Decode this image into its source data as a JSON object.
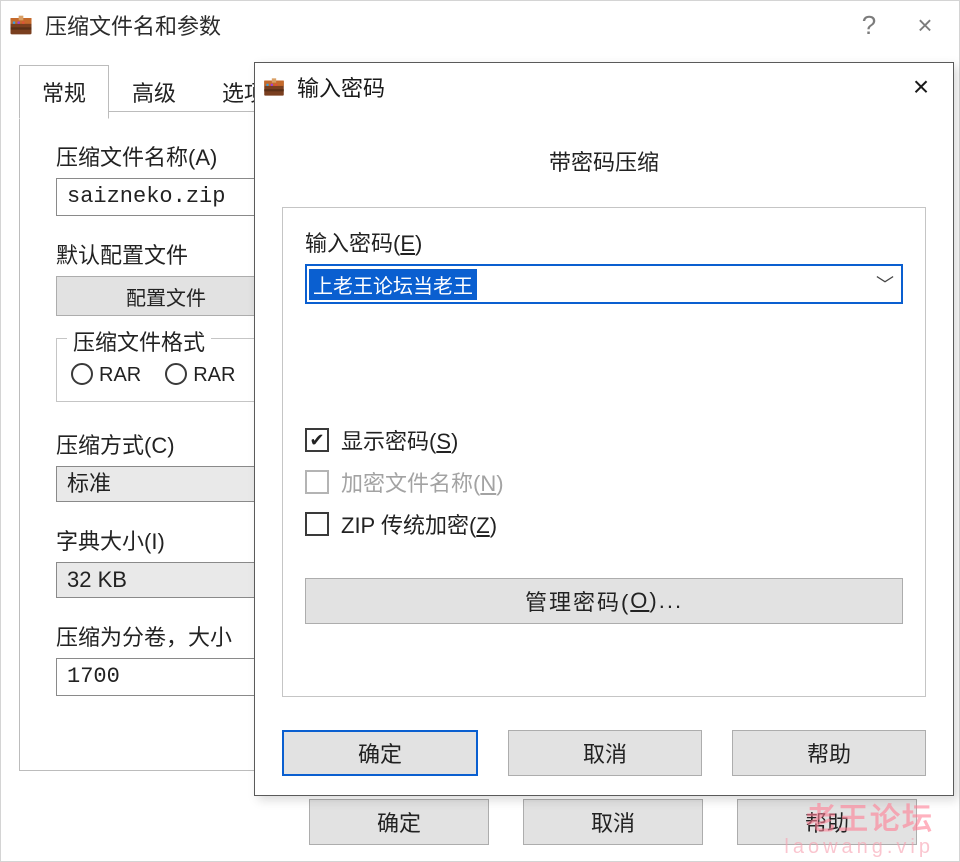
{
  "main": {
    "title": "压缩文件名和参数",
    "help_hint": "?",
    "close_hint": "×",
    "tabs": {
      "general": "常规",
      "advanced": "高级",
      "options": "选项"
    },
    "archive_name_label": "压缩文件名称(A)",
    "archive_name_value": "saizneko.zip",
    "default_profile_label": "默认配置文件",
    "profile_button": "配置文件",
    "format_group_label": "压缩文件格式",
    "format_rar": "RAR",
    "format_rar5": "RAR",
    "method_label": "压缩方式(C)",
    "method_value": "标准",
    "dict_label": "字典大小(I)",
    "dict_value": "32 KB",
    "split_label": "压缩为分卷，大小",
    "split_value": "1700",
    "buttons": {
      "ok": "确定",
      "cancel": "取消",
      "help": "帮助"
    }
  },
  "pwd": {
    "title": "输入密码",
    "close_hint": "×",
    "caption": "带密码压缩",
    "enter_label_pre": "输入密码(",
    "enter_label_hot": "E",
    "enter_label_post": ")",
    "value": "上老王论坛当老王",
    "show_pre": "显示密码(",
    "show_hot": "S",
    "show_post": ")",
    "encrypt_pre": "加密文件名称(",
    "encrypt_hot": "N",
    "encrypt_post": ")",
    "zip_pre": "ZIP 传统加密(",
    "zip_hot": "Z",
    "zip_post": ")",
    "manage_pre": "管理密码(",
    "manage_hot": "O",
    "manage_post": ")...",
    "buttons": {
      "ok": "确定",
      "cancel": "取消",
      "help": "帮助"
    }
  },
  "watermark": {
    "line1": "老王论坛",
    "line2": "laowang.vip"
  }
}
